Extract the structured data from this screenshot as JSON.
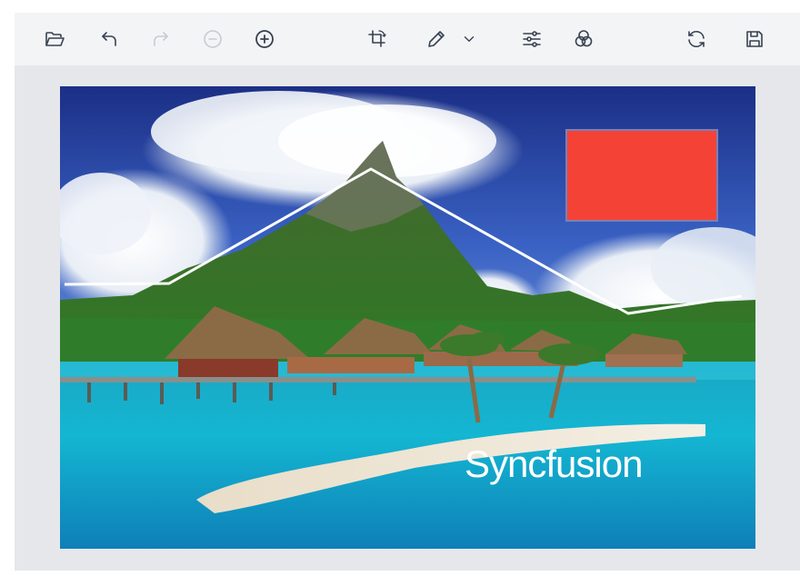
{
  "toolbar": {
    "buttons": [
      {
        "name": "open-button",
        "icon": "folder-open-icon",
        "enabled": true
      },
      {
        "name": "undo-button",
        "icon": "undo-icon",
        "enabled": true
      },
      {
        "name": "redo-button",
        "icon": "redo-icon",
        "enabled": false
      },
      {
        "name": "zoom-out-button",
        "icon": "zoom-out-icon",
        "enabled": false
      },
      {
        "name": "zoom-in-button",
        "icon": "zoom-in-icon",
        "enabled": true
      },
      {
        "name": "crop-button",
        "icon": "crop-icon",
        "enabled": true
      },
      {
        "name": "annotate-button",
        "icon": "pencil-icon",
        "enabled": true
      },
      {
        "name": "annotate-dropdown",
        "icon": "chevron-down-icon",
        "enabled": true
      },
      {
        "name": "adjust-button",
        "icon": "sliders-icon",
        "enabled": true
      },
      {
        "name": "filter-button",
        "icon": "circles-icon",
        "enabled": true
      },
      {
        "name": "reset-button",
        "icon": "refresh-icon",
        "enabled": true
      },
      {
        "name": "save-button",
        "icon": "save-icon",
        "enabled": true
      }
    ]
  },
  "annotations": {
    "text": {
      "value": "Syncfusion",
      "color": "#ffffff"
    },
    "rectangle": {
      "fill": "#f44336",
      "stroke": "#7c7fb8"
    },
    "path": {
      "stroke": "#ffffff"
    }
  },
  "colors": {
    "icon": "#374151",
    "icon_disabled": "#c7cbd1",
    "toolbar_bg": "#f3f4f6",
    "canvas_bg": "#e5e7eb"
  }
}
